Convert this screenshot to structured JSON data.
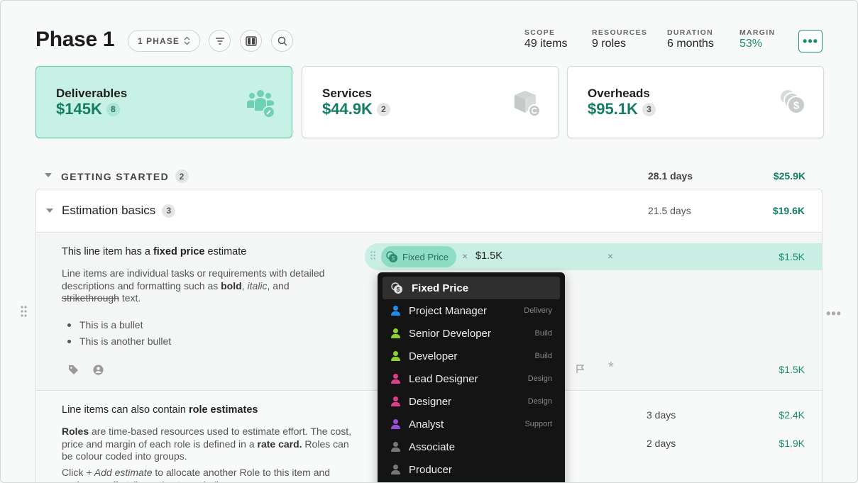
{
  "header": {
    "title": "Phase 1",
    "phase_selector": "1 PHASE",
    "stats": [
      {
        "label": "SCOPE",
        "value": "49 items"
      },
      {
        "label": "RESOURCES",
        "value": "9 roles"
      },
      {
        "label": "DURATION",
        "value": "6 months"
      },
      {
        "label": "MARGIN",
        "value": "53%"
      }
    ],
    "more": "•••"
  },
  "cards": [
    {
      "name": "Deliverables",
      "amount": "$145K",
      "count": "8",
      "icon": "people-wrench-icon"
    },
    {
      "name": "Services",
      "amount": "$44.9K",
      "count": "2",
      "icon": "box-refresh-icon"
    },
    {
      "name": "Overheads",
      "amount": "$95.1K",
      "count": "3",
      "icon": "coins-dollar-icon"
    }
  ],
  "group": {
    "title": "GETTING STARTED",
    "count": "2",
    "days": "28.1 days",
    "amount": "$25.9K"
  },
  "section": {
    "title": "Estimation basics",
    "count": "3",
    "days": "21.5 days",
    "amount": "$19.6K"
  },
  "item1": {
    "title_pre": "This line item has a ",
    "title_bold": "fixed price",
    "title_post": " estimate",
    "desc_1": "Line items are individual tasks or requirements with detailed descriptions and formatting such as ",
    "desc_bold": "bold",
    "desc_sep1": ", ",
    "desc_italic": "italic",
    "desc_sep2": ", and",
    "desc_strike": "strikethrough",
    "desc_end": " text.",
    "bullets": [
      "This is a bullet",
      "This is another bullet"
    ],
    "estimate": {
      "chip": "Fixed Price",
      "value": "$1.5K",
      "amount": "$1.5K"
    },
    "total": "$1.5K"
  },
  "item2": {
    "title_pre": "Line items can also contain ",
    "title_bold": "role estimates",
    "desc_b1": "Roles",
    "desc_1": " are time-based resources used to estimate effort. The cost, price and margin of each role is defined in a ",
    "desc_b2": "rate card.",
    "desc_2": " Roles can be colour coded into groups.",
    "desc_3_pre": "Click ",
    "desc_3_italic": "+ Add estimate",
    "desc_3_post": " to allocate another Role to this item and assign an effort (in. estimate period).",
    "rows": [
      {
        "days": "3 days",
        "amount": "$2.4K"
      },
      {
        "days": "2 days",
        "amount": "$1.9K"
      }
    ]
  },
  "dropdown": {
    "items": [
      {
        "label": "Fixed Price",
        "tag": "",
        "color": "#8fdcc5"
      },
      {
        "label": "Project Manager",
        "tag": "Delivery",
        "color": "#1e8ff0"
      },
      {
        "label": "Senior Developer",
        "tag": "Build",
        "color": "#8cd12b"
      },
      {
        "label": "Developer",
        "tag": "Build",
        "color": "#8cd12b"
      },
      {
        "label": "Lead Designer",
        "tag": "Design",
        "color": "#e23c8f"
      },
      {
        "label": "Designer",
        "tag": "Design",
        "color": "#e23c8f"
      },
      {
        "label": "Analyst",
        "tag": "Support",
        "color": "#9a4fd6"
      },
      {
        "label": "Associate",
        "tag": "",
        "color": "#777777"
      },
      {
        "label": "Producer",
        "tag": "",
        "color": "#777777"
      }
    ]
  }
}
